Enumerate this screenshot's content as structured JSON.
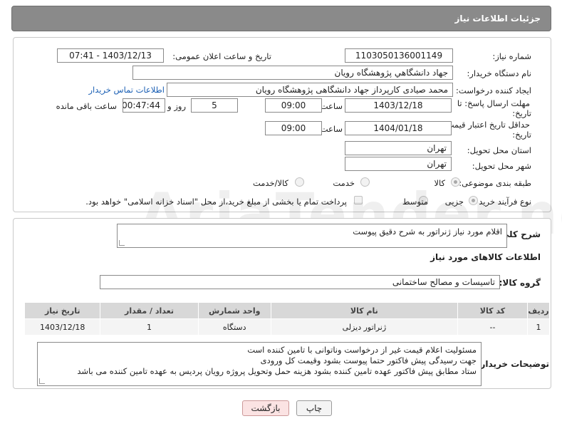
{
  "header": {
    "title": "جزئیات اطلاعات نیاز"
  },
  "fields": {
    "need_number_label": "شماره نیاز:",
    "need_number": "1103050136001149",
    "announce_label": "تاریخ و ساعت اعلان عمومی:",
    "announce_value": "1403/12/13 - 07:41",
    "buyer_org_label": "نام دستگاه خریدار:",
    "buyer_org": "جهاد دانشگاهي پژوهشگاه رويان",
    "requester_label": "ایجاد کننده درخواست:",
    "requester": "محمد صیادی کارپرداز جهاد دانشگاهی پژوهشگاه رویان",
    "contact_link": "اطلاعات تماس خریدار",
    "deadline_label_1": "مهلت ارسال پاسخ: تا",
    "deadline_label_2": "تاریخ:",
    "deadline_date": "1403/12/18",
    "time_label": "ساعت",
    "deadline_time": "09:00",
    "days_value": "5",
    "days_label": "روز و",
    "remaining_time": "00:47:44",
    "remaining_label": "ساعت باقی مانده",
    "validity_label_1": "حداقل تاریخ اعتبار قیمت: تا",
    "validity_label_2": "تاریخ:",
    "validity_date": "1404/01/18",
    "validity_time": "09:00",
    "province_label": "استان محل تحویل:",
    "province": "تهران",
    "city_label": "شهر محل تحویل:",
    "city": "تهران",
    "category_label": "طبقه بندی موضوعی:",
    "category_options": [
      "کالا",
      "خدمت",
      "کالا/خدمت"
    ],
    "process_label": "نوع فرآیند خرید :",
    "process_options": [
      "جزیی",
      "متوسط"
    ],
    "payment_note": "پرداخت تمام یا بخشی از مبلغ خرید،از محل \"اسناد خزانه اسلامی\" خواهد بود."
  },
  "description": {
    "label": "شرح کلی نیاز:",
    "value": "اقلام مورد نیاز ژنراتور به شرح دقیق پیوست"
  },
  "goods": {
    "section_title": "اطلاعات کالاهای مورد نیاز",
    "group_label": "گروه کالا:",
    "group_value": "تاسیسات و مصالح ساختمانی",
    "columns": [
      "ردیف",
      "کد کالا",
      "نام کالا",
      "واحد شمارش",
      "تعداد / مقدار",
      "تاریخ نیاز"
    ],
    "rows": [
      {
        "row": "1",
        "code": "--",
        "name": "ژنراتور دیزلی",
        "unit": "دستگاه",
        "qty": "1",
        "date": "1403/12/18"
      }
    ]
  },
  "buyer_notes": {
    "label": "توضیحات خریدار:",
    "lines": [
      "مسئولیت اعلام قیمت  غیر از درخواست وناتوانی با تامین کننده است",
      "جهت رسیدگی پیش فاکتور حتما پیوست بشود وقیمت کل ورودی",
      "ستاد مطابق پیش فاکتور عهده تامین کننده بشود هزینه حمل وتحویل پروژه رویان پردیس به عهده تامین کننده می باشد"
    ]
  },
  "buttons": {
    "print": "چاپ",
    "back": "بازگشت"
  },
  "watermark": "AriaTender.net"
}
